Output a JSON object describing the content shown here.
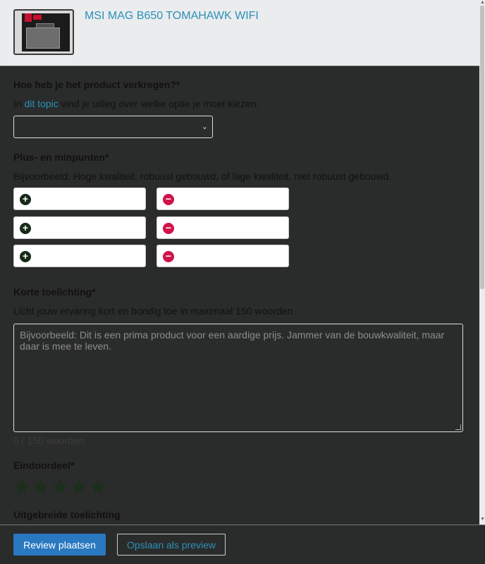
{
  "product": {
    "title": "MSI MAG B650 TOMAHAWK WIFI",
    "image": "motherboard-product-image"
  },
  "acquired": {
    "label": "Hoe heb je het product verkregen?*",
    "desc_prefix": "In ",
    "desc_link": "dit topic",
    "desc_suffix": " vind je uitleg over welke optie je moet kiezen.",
    "select_value": ""
  },
  "proscons": {
    "label": "Plus- en minpunten*",
    "example": "Bijvoorbeeld: Hoge kwaliteit, robuust gebouwd, of lage kwaliteit, niet robuust gebouwd.",
    "plus_icon": "plus-circle-icon",
    "minus_icon": "minus-circle-icon",
    "rows": 3
  },
  "short": {
    "label": "Korte toelichting*",
    "desc": "Licht jouw ervaring kort en bondig toe in maximaal 150 woorden.",
    "placeholder": "Bijvoorbeeld: Dit is een prima product voor een aardige prijs. Jammer van de bouwkwaliteit, maar daar is mee te leven.",
    "counter": "0 / 150 woorden"
  },
  "rating": {
    "label": "Eindoordeel*",
    "stars": 5,
    "value": 0,
    "star_icon": "star-icon"
  },
  "extended": {
    "label": "Uitgebreide toelichting"
  },
  "footer": {
    "submit": "Review plaatsen",
    "preview": "Opslaan als preview"
  },
  "colors": {
    "accent": "#2a91b8",
    "primary": "#2978c0",
    "minus": "#d0134a",
    "plus": "#172a17",
    "star": "#1c2e1c"
  }
}
